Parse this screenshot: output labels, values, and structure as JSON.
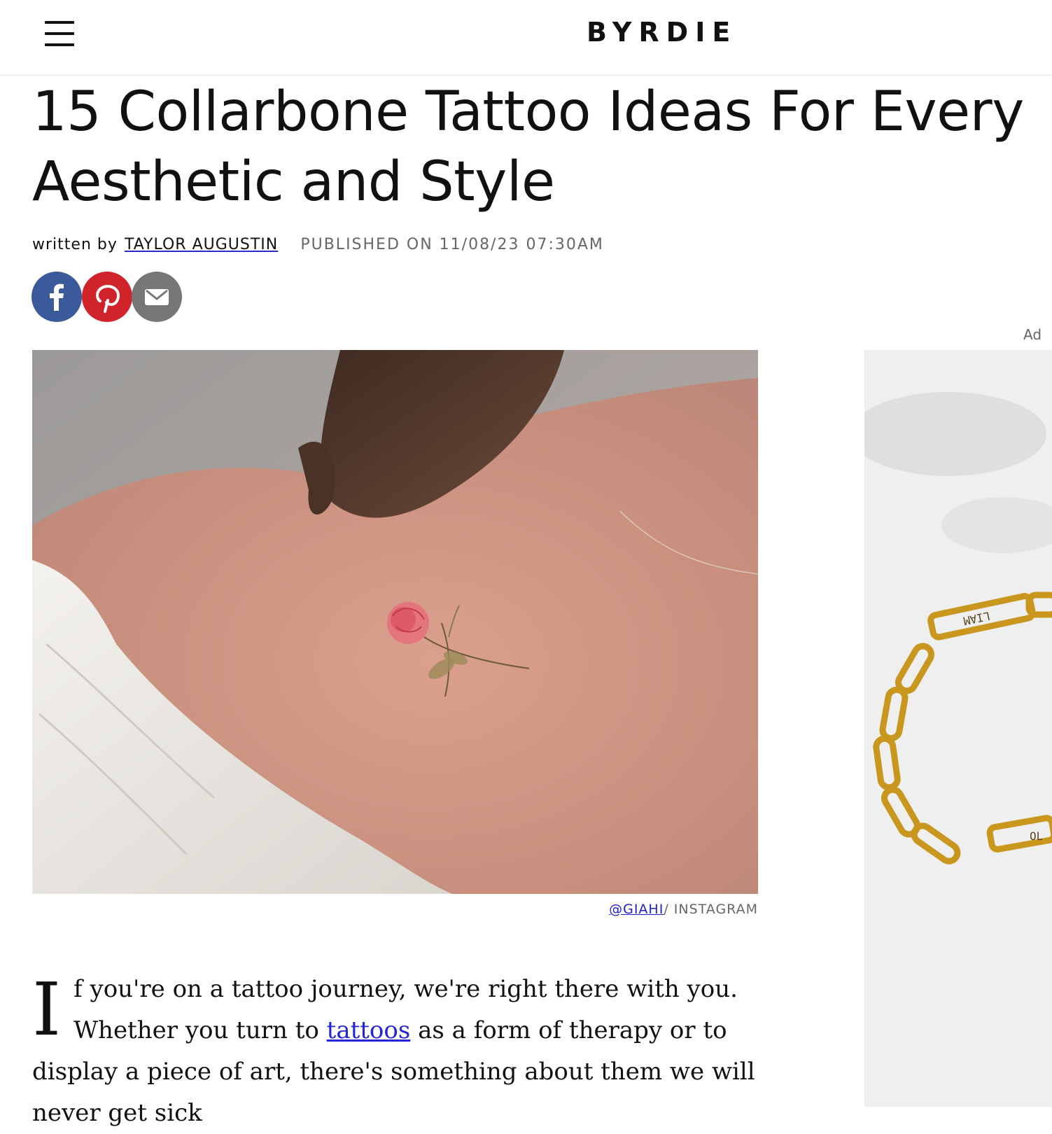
{
  "header": {
    "logo": "BYRDIE",
    "menu_icon": "hamburger-menu-icon"
  },
  "article": {
    "title": "15 Collarbone Tattoo Ideas For Every Aesthetic and Style",
    "byline_prefix": "written by",
    "author": "TAYLOR AUGUSTIN",
    "published": "PUBLISHED ON 11/08/23 07:30AM"
  },
  "social": {
    "facebook_icon": "facebook-icon",
    "pinterest_icon": "pinterest-icon",
    "email_icon": "email-icon",
    "colors": {
      "facebook": "#3b5a9a",
      "pinterest": "#d1232a",
      "email": "#777777"
    }
  },
  "image_caption": {
    "handle": "@GIAHI",
    "source": "/ INSTAGRAM"
  },
  "ad": {
    "label": "Ad",
    "tag1": "LIAM",
    "tag2": "OL"
  },
  "body": {
    "dropcap": "I",
    "text_before_link": "f you're on a tattoo journey, we're right there with you. Whether you turn to ",
    "link_text": "tattoos",
    "text_after_link": " as a form of therapy or to display a piece of art, there's something about them we will never get sick"
  }
}
